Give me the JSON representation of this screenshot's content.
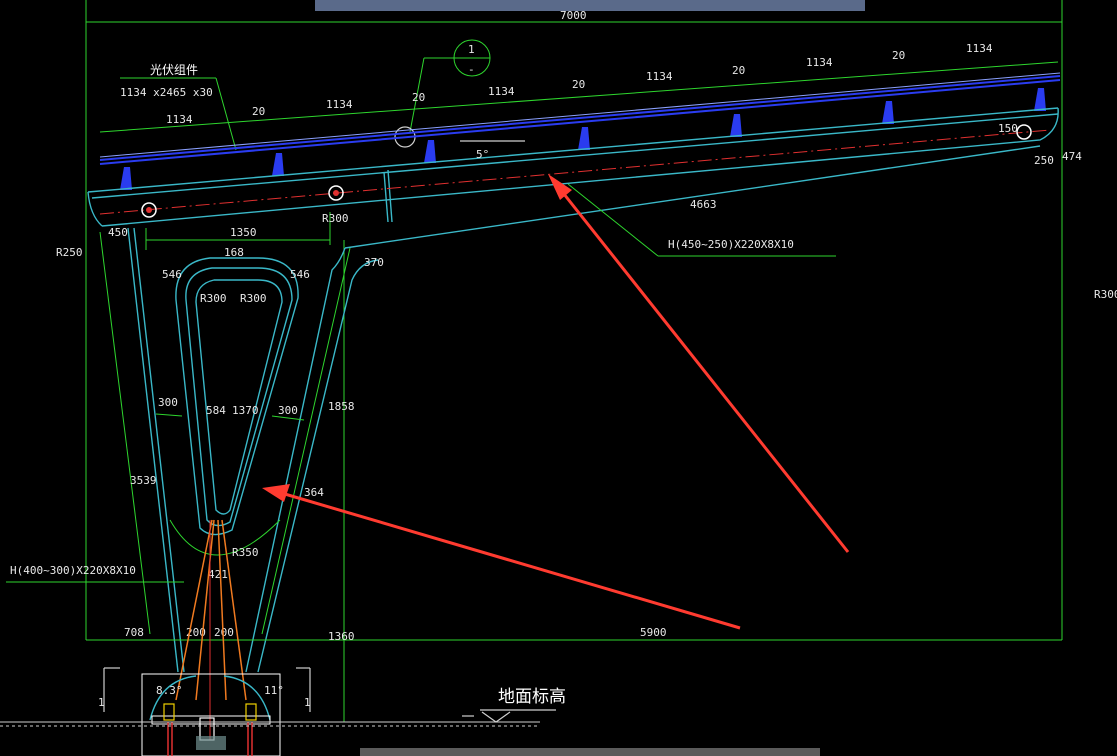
{
  "title_dim": "7000",
  "section_tag": {
    "number": "1",
    "sub": "-"
  },
  "pv_module": {
    "name": "光伏组件",
    "spec": "1134 x2465 x30"
  },
  "panel_dims": [
    "1134",
    "20",
    "1134",
    "20",
    "1134",
    "20",
    "1134",
    "20",
    "1134",
    "20",
    "1134"
  ],
  "angle": "5°",
  "dims": {
    "d450": "450",
    "d1350": "1350",
    "d168": "168",
    "d546a": "546",
    "d546b": "546",
    "r300a": "R300",
    "r300b": "R300",
    "r300c": "R300",
    "r250": "R250",
    "r300d": "R300",
    "d370": "370",
    "d4663": "4663",
    "d250": "250",
    "d474": "474",
    "d150": "150",
    "d300a": "300",
    "d300b": "300",
    "d584": "584",
    "d1370": "1370",
    "d1858": "1858",
    "d3539": "3539",
    "d364": "364",
    "r350": "R350",
    "d421": "421",
    "d708": "708",
    "d200a": "200",
    "d200b": "200",
    "d1360": "1360",
    "d5900": "5900",
    "ang83": "8.3°",
    "ang11": "11°"
  },
  "beam_spec": "H(450~250)X220X8X10",
  "column_spec": "H(400~300)X220X8X10",
  "section_marks": [
    "1",
    "1"
  ],
  "ground_label": "地面标高",
  "colors": {
    "dim_line": "#2ed52e",
    "steel": "#3ab8c8",
    "center": "#e03030",
    "panel": "#2a3cf0",
    "arrow": "#ff3b30",
    "bolt": "#f07a20"
  }
}
